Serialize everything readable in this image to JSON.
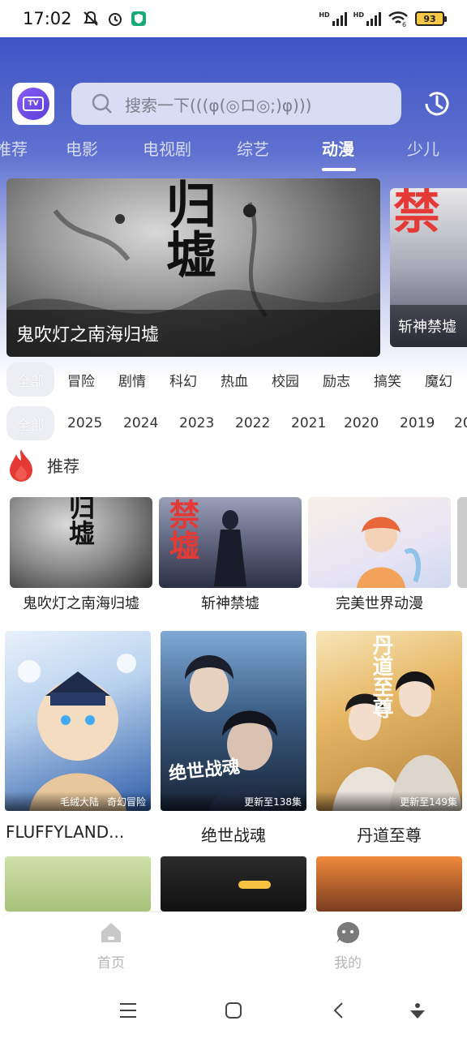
{
  "status_bar": {
    "time": "17:02",
    "battery": "93",
    "network_a": "HD",
    "network_b": "HD",
    "wifi_badge": "6"
  },
  "header": {
    "search_placeholder": "搜索一下(((φ(◎ロ◎;)φ)))",
    "tabs": [
      "推荐",
      "电影",
      "电视剧",
      "综艺",
      "动漫",
      "少儿"
    ],
    "active_tab": "动漫",
    "app_logo_text": "TV"
  },
  "banner": {
    "main_title": "鬼吹灯之南海归墟",
    "main_art_text": "归墟",
    "side_title": "斩神禁墟",
    "side_art_text": "禁"
  },
  "genre_filters": [
    "全部",
    "冒险",
    "剧情",
    "科幻",
    "热血",
    "校园",
    "励志",
    "搞笑",
    "魔幻"
  ],
  "year_filters": [
    "全部",
    "2025",
    "2024",
    "2023",
    "2022",
    "2021",
    "2020",
    "2019",
    "20"
  ],
  "section": {
    "title": "推荐"
  },
  "recommend_cards": [
    {
      "title": "鬼吹灯之南海归墟",
      "art": "归墟"
    },
    {
      "title": "斩神禁墟",
      "art": "禁墟"
    },
    {
      "title": "完美世界动漫",
      "art": ""
    }
  ],
  "posters": [
    {
      "title": "FLUFFYLAND...",
      "tags": [
        "毛绒大陆",
        "奇幻冒险"
      ],
      "art": ""
    },
    {
      "title": "绝世战魂",
      "tags": [
        "更新至138集"
      ],
      "art": "绝世战魂"
    },
    {
      "title": "丹道至尊",
      "tags": [
        "更新至149集"
      ],
      "art": "丹道至尊"
    }
  ],
  "bottom_nav": {
    "home": "首页",
    "mine": "我的"
  },
  "colors": {
    "header_top": "#3f55c4",
    "accent": "#e53935",
    "chip_bg": "#eceef3"
  }
}
